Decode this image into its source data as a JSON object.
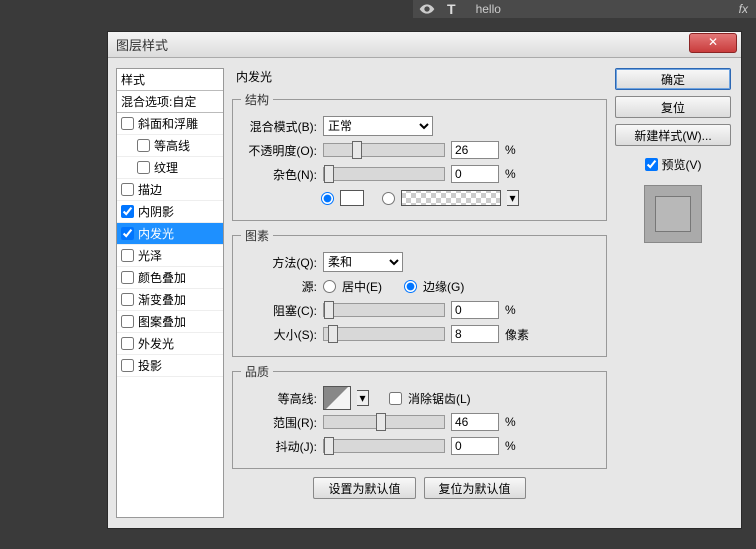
{
  "layers_panel": {
    "layer_name": "hello",
    "text_symbol": "T",
    "fx": "fx"
  },
  "dialog": {
    "title": "图层样式",
    "close": "✕",
    "left": {
      "header": "样式",
      "blend": "混合选项:自定",
      "items": [
        {
          "label": "斜面和浮雕",
          "checked": false,
          "sub": false
        },
        {
          "label": "等高线",
          "checked": false,
          "sub": true
        },
        {
          "label": "纹理",
          "checked": false,
          "sub": true
        },
        {
          "label": "描边",
          "checked": false,
          "sub": false
        },
        {
          "label": "内阴影",
          "checked": true,
          "sub": false
        },
        {
          "label": "内发光",
          "checked": true,
          "sub": false,
          "selected": true
        },
        {
          "label": "光泽",
          "checked": false,
          "sub": false
        },
        {
          "label": "颜色叠加",
          "checked": false,
          "sub": false
        },
        {
          "label": "渐变叠加",
          "checked": false,
          "sub": false
        },
        {
          "label": "图案叠加",
          "checked": false,
          "sub": false
        },
        {
          "label": "外发光",
          "checked": false,
          "sub": false
        },
        {
          "label": "投影",
          "checked": false,
          "sub": false
        }
      ]
    },
    "panel_title": "内发光",
    "structure": {
      "legend": "结构",
      "blendmode_label": "混合模式(B):",
      "blendmode_value": "正常",
      "opacity_label": "不透明度(O):",
      "opacity_value": "26",
      "opacity_unit": "%",
      "noise_label": "杂色(N):",
      "noise_value": "0",
      "noise_unit": "%"
    },
    "elements": {
      "legend": "图素",
      "technique_label": "方法(Q):",
      "technique_value": "柔和",
      "source_label": "源:",
      "source_center": "居中(E)",
      "source_edge": "边缘(G)",
      "choke_label": "阻塞(C):",
      "choke_value": "0",
      "choke_unit": "%",
      "size_label": "大小(S):",
      "size_value": "8",
      "size_unit": "像素"
    },
    "quality": {
      "legend": "品质",
      "contour_label": "等高线:",
      "aa_label": "消除锯齿(L)",
      "range_label": "范围(R):",
      "range_value": "46",
      "range_unit": "%",
      "jitter_label": "抖动(J):",
      "jitter_value": "0",
      "jitter_unit": "%"
    },
    "default_buttons": {
      "set_default": "设置为默认值",
      "reset_default": "复位为默认值"
    },
    "right": {
      "ok": "确定",
      "cancel": "复位",
      "new_style": "新建样式(W)...",
      "preview": "预览(V)"
    }
  }
}
